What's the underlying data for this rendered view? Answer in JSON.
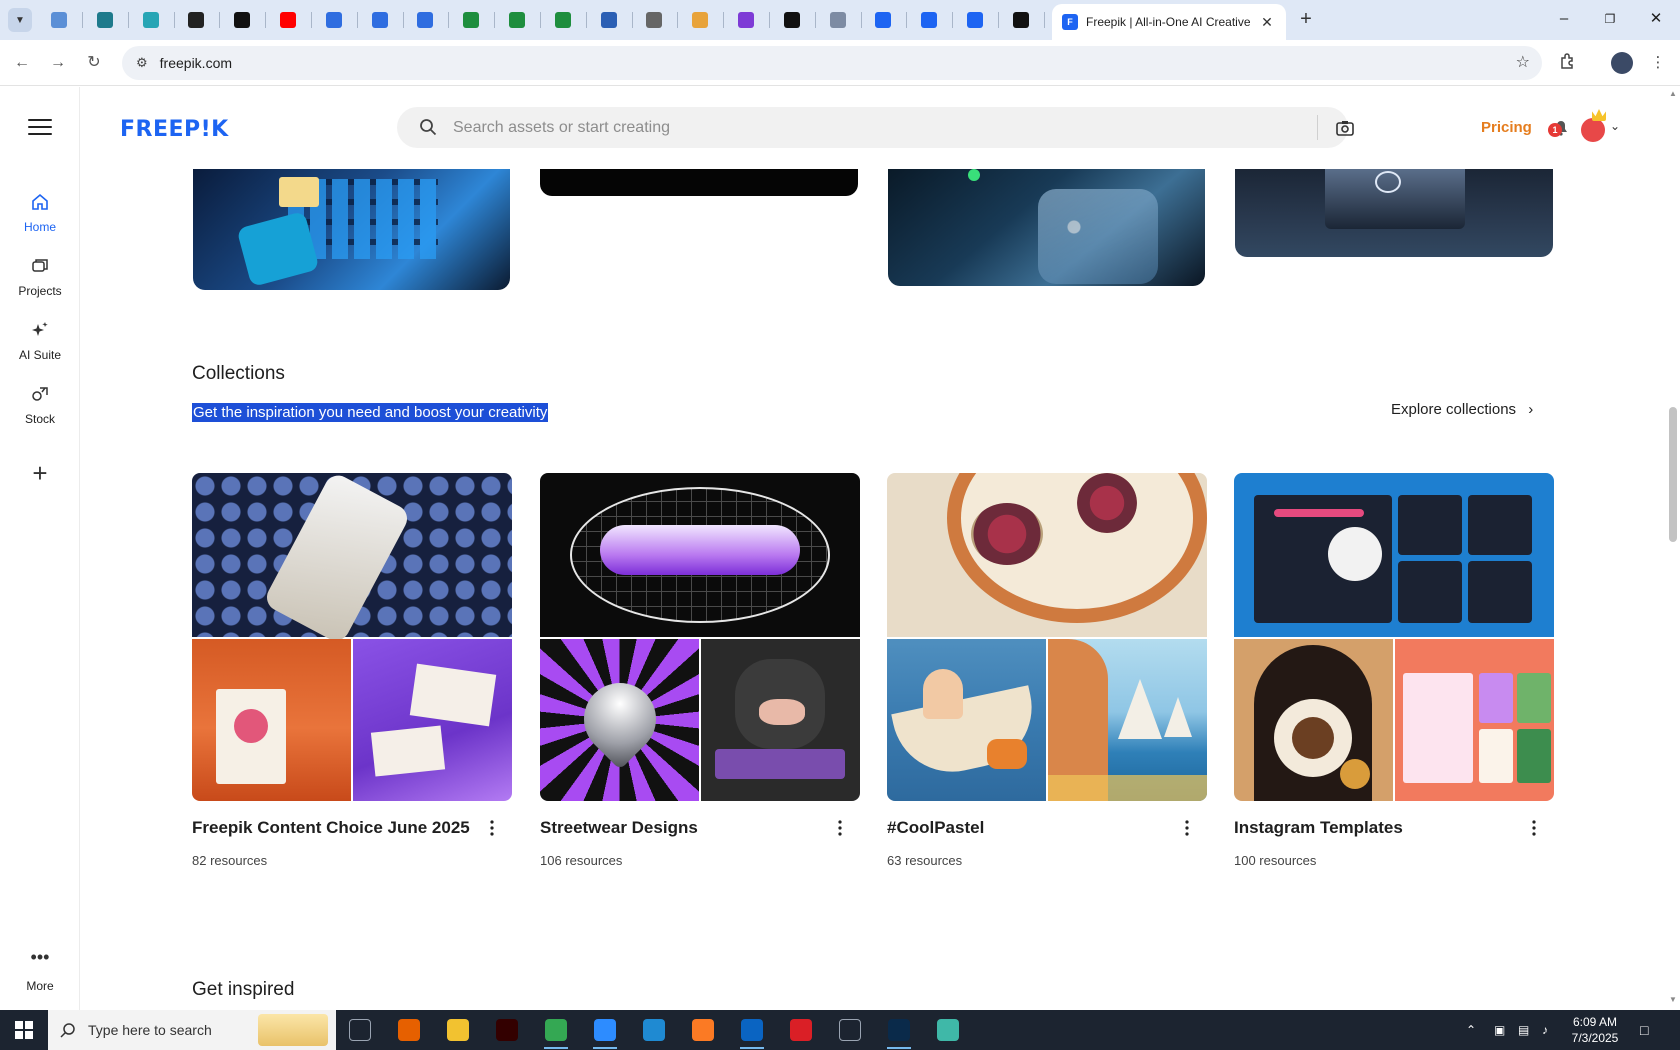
{
  "browser": {
    "active_tab_title": "Freepik | All-in-One AI Creative",
    "url": "freepik.com",
    "pinned_tabs": [
      {
        "icon": "globe-blue-icon",
        "color": "#5b8fd6"
      },
      {
        "icon": "vpn-shield-icon",
        "color": "#1e7a8c"
      },
      {
        "icon": "play-circle-icon",
        "color": "#27a5b5"
      },
      {
        "icon": "openai-icon",
        "color": "#222222"
      },
      {
        "icon": "bolt-icon",
        "color": "#111111"
      },
      {
        "icon": "youtube-icon",
        "color": "#ff0000"
      },
      {
        "icon": "docs-icon",
        "color": "#2f6de0"
      },
      {
        "icon": "docs-icon",
        "color": "#2f6de0"
      },
      {
        "icon": "docs-icon",
        "color": "#2f6de0"
      },
      {
        "icon": "sheets-icon",
        "color": "#1e8e3e"
      },
      {
        "icon": "sheets-icon",
        "color": "#1e8e3e"
      },
      {
        "icon": "sheets-icon",
        "color": "#1e8e3e"
      },
      {
        "icon": "word-icon",
        "color": "#2b5fb4"
      },
      {
        "icon": "globe-grey-icon",
        "color": "#666666"
      },
      {
        "icon": "bird-icon",
        "color": "#e8a33b"
      },
      {
        "icon": "code-braces-icon",
        "color": "#7d3ad6"
      },
      {
        "icon": "letter-a-icon",
        "color": "#111111"
      },
      {
        "icon": "grid-icon",
        "color": "#7d8ba3"
      },
      {
        "icon": "freepik-icon",
        "color": "#1d64f2"
      },
      {
        "icon": "freepik-icon",
        "color": "#1d64f2"
      },
      {
        "icon": "freepik-icon",
        "color": "#1d64f2"
      },
      {
        "icon": "letter-m-icon",
        "color": "#111111"
      }
    ]
  },
  "sidebar": {
    "items": [
      {
        "label": "Home",
        "icon": "home-icon"
      },
      {
        "label": "Projects",
        "icon": "projects-icon"
      },
      {
        "label": "AI Suite",
        "icon": "sparkle-icon"
      },
      {
        "label": "Stock",
        "icon": "stock-icon"
      }
    ],
    "more_label": "More"
  },
  "header": {
    "logo": "FREEP!K",
    "search_placeholder": "Search assets or start creating",
    "pricing_label": "Pricing",
    "notification_count": "1",
    "accent_color": "#1d64f2",
    "pricing_color": "#e57d1e"
  },
  "collections": {
    "title": "Collections",
    "subtitle": "Get the inspiration you need and boost your creativity",
    "explore_label": "Explore collections",
    "items": [
      {
        "name": "Freepik Content Choice June 2025",
        "count": "82 resources"
      },
      {
        "name": "Streetwear Designs",
        "count": "106 resources"
      },
      {
        "name": "#CoolPastel",
        "count": "63 resources"
      },
      {
        "name": "Instagram Templates",
        "count": "100 resources"
      }
    ]
  },
  "next_section_title": "Get inspired",
  "taskbar": {
    "search_placeholder": "Type here to search",
    "time": "6:09 AM",
    "date": "7/3/2025",
    "apps": [
      {
        "icon": "task-view-icon",
        "color": "#1c2430"
      },
      {
        "icon": "firefox-icon",
        "color": "#e66000"
      },
      {
        "icon": "file-explorer-icon",
        "color": "#f2c230"
      },
      {
        "icon": "illustrator-icon",
        "color": "#330000"
      },
      {
        "icon": "chrome-icon",
        "color": "#34a853"
      },
      {
        "icon": "zoom-icon",
        "color": "#2d8cff"
      },
      {
        "icon": "vscode-icon",
        "color": "#1f8ad2"
      },
      {
        "icon": "xampp-icon",
        "color": "#fb7a24"
      },
      {
        "icon": "outlook-icon",
        "color": "#0a64c2"
      },
      {
        "icon": "creative-cloud-icon",
        "color": "#da1f26"
      },
      {
        "icon": "pen-tool-icon",
        "color": "#1c2430"
      },
      {
        "icon": "photoshop-icon",
        "color": "#0a2a4a"
      },
      {
        "icon": "app-diamond-icon",
        "color": "#3fb8a8"
      }
    ]
  }
}
